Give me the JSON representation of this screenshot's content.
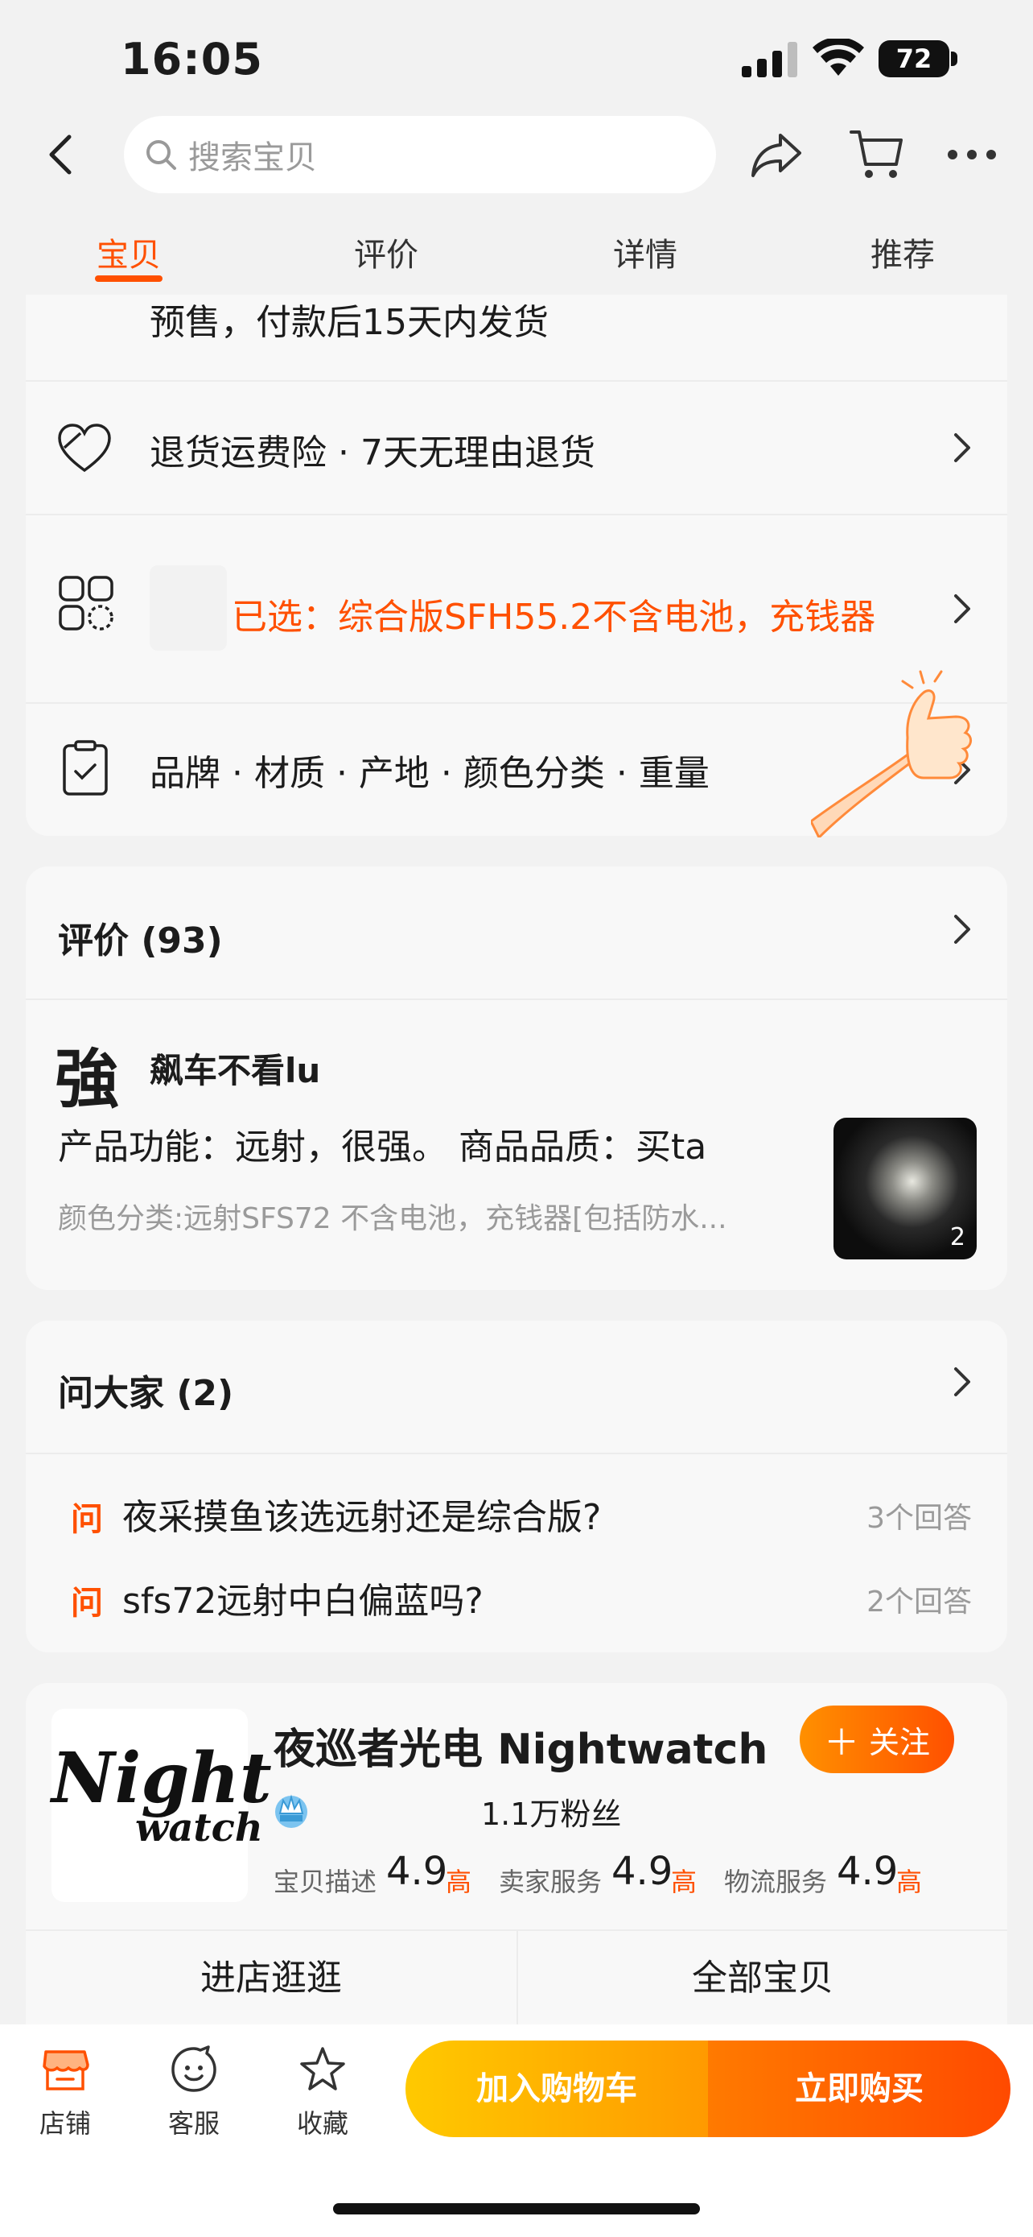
{
  "status_bar": {
    "time": "16:05",
    "battery": "72"
  },
  "nav": {
    "search_placeholder": "搜索宝贝"
  },
  "tabs": [
    {
      "label": "宝贝",
      "active": true
    },
    {
      "label": "评价",
      "active": false
    },
    {
      "label": "详情",
      "active": false
    },
    {
      "label": "推荐",
      "active": false
    }
  ],
  "info_card": {
    "shipping_note": "预售，付款后15天内发货",
    "return_policy": "退货运费险 · 7天无理由退货",
    "selected_variant": "已选：综合版SFH55.2不含电池，充钱器",
    "params": "品牌 · 材质 · 产地 · 颜色分类 · 重量"
  },
  "reviews": {
    "title": "评价 (93)",
    "avatar_char": "強",
    "username": "飙车不看lu",
    "text": "产品功能：远射，很强。 商品品质：买ta",
    "sku": "颜色分类:远射SFS72 不含电池，充钱器[包括防水...",
    "photo_count": "2"
  },
  "qa": {
    "title": "问大家 (2)",
    "icon_label": "问",
    "items": [
      {
        "question": "夜采摸鱼该选远射还是综合版?",
        "answers": "3个回答"
      },
      {
        "question": "sfs72远射中白偏蓝吗?",
        "answers": "2个回答"
      }
    ]
  },
  "shop": {
    "logo_line1": "Night",
    "logo_line2": "watch",
    "name": "夜巡者光电 Nightwatch",
    "follow_label": "关注",
    "fans": "1.1万粉丝",
    "scores": [
      {
        "label": "宝贝描述",
        "value": "4.9",
        "level": "高"
      },
      {
        "label": "卖家服务",
        "value": "4.9",
        "level": "高"
      },
      {
        "label": "物流服务",
        "value": "4.9",
        "level": "高"
      }
    ],
    "enter_shop": "进店逛逛",
    "all_items": "全部宝贝"
  },
  "bottom_bar": {
    "store_label": "店铺",
    "service_label": "客服",
    "favorite_label": "收藏",
    "add_to_cart": "加入购物车",
    "buy_now": "立即购买"
  },
  "colors": {
    "accent": "#ff5000",
    "cart_button": "#ffb300",
    "buy_button": "#ff5a00"
  }
}
